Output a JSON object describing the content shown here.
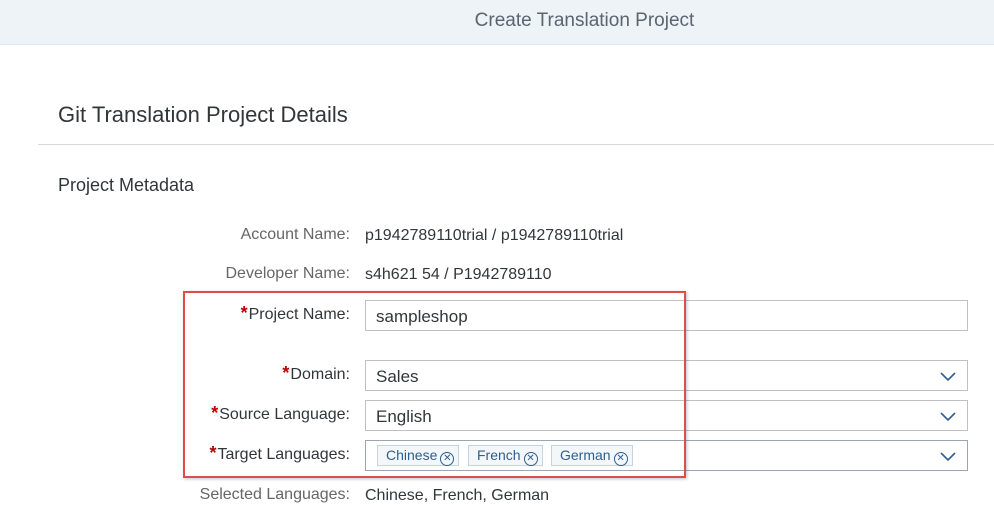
{
  "header": {
    "title": "Create Translation Project"
  },
  "section": {
    "title": "Git Translation Project Details"
  },
  "subsection": {
    "title": "Project Metadata"
  },
  "fields": {
    "account_name": {
      "label": "Account Name:",
      "value": "p1942789110trial / p1942789110trial"
    },
    "developer_name": {
      "label": "Developer Name:",
      "value": "s4h621 54 / P1942789110"
    },
    "project_name": {
      "required": "*",
      "label": "Project Name:",
      "value": "sampleshop"
    },
    "domain": {
      "required": "*",
      "label": "Domain:",
      "value": "Sales"
    },
    "source_language": {
      "required": "*",
      "label": "Source Language:",
      "value": "English"
    },
    "target_languages": {
      "required": "*",
      "label": "Target Languages:",
      "tokens": [
        "Chinese",
        "French",
        "German"
      ],
      "remove_glyph": "⊗"
    },
    "selected_languages": {
      "label": "Selected Languages:",
      "value": "Chinese, French, German"
    }
  },
  "icons": {
    "dropdown": "chevron-down-icon",
    "token_remove": "remove-token-icon"
  },
  "colors": {
    "accent": "#2e5e8f",
    "required": "#bb0000",
    "highlight": "#e04b4b",
    "header_bg": "#edf3f7"
  }
}
